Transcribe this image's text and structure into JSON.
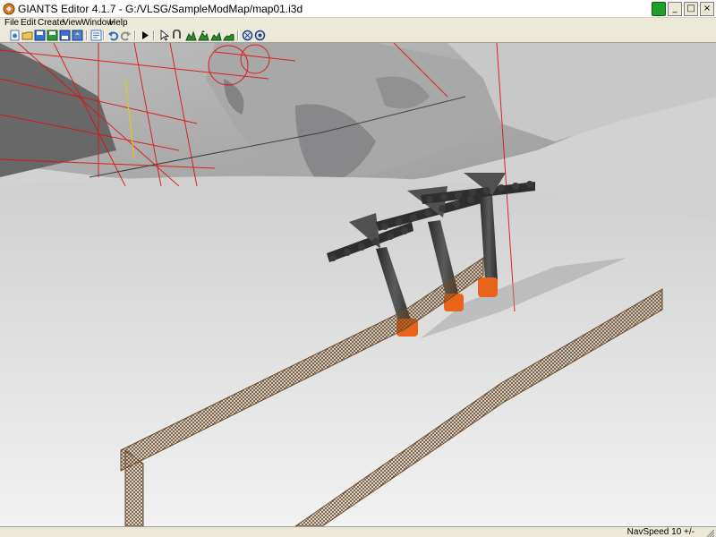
{
  "window": {
    "title": "GIANTS Editor 4.1.7 - G:/VLSG/SampleModMap/map01.i3d",
    "app_icon": "giants-logo-icon",
    "tray_icon": "green-status-icon",
    "controls": {
      "minimize": "_",
      "maximize": "□",
      "close": "×"
    }
  },
  "menu": {
    "items": [
      "File",
      "Edit",
      "Create",
      "View",
      "Window",
      "Help"
    ]
  },
  "toolbar": {
    "buttons": [
      "new-file-icon",
      "open-folder-icon",
      "save-icon",
      "save-as-icon",
      "export-icon",
      "import-icon",
      "properties-icon",
      "undo-icon",
      "redo-icon",
      "play-icon",
      "select-tool-icon",
      "move-tool-icon",
      "terrain-paint-icon",
      "terrain-raise-icon",
      "terrain-lower-icon",
      "terrain-smooth-icon",
      "foliage-icon",
      "fill-icon"
    ]
  },
  "viewport": {
    "description_icon": "3d-scene-icon",
    "scene": "snow-slope-with-ski-lift-towers-and-fences",
    "colors": {
      "snow": "#e6e6e6",
      "slope": "#c9c9c9",
      "tower": "#3b3b3b",
      "tower_base": "#e8641a",
      "fence": "#7a5a3a",
      "debug_lines": "#e01010"
    }
  },
  "status": {
    "navspeed": "NavSpeed 10 +/-"
  }
}
